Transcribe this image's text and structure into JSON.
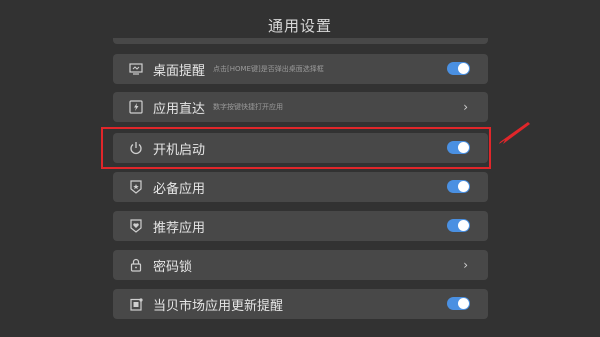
{
  "header": {
    "title": "通用设置"
  },
  "rows": [
    {
      "label": "桌面提醒",
      "desc": "点击[HOME键]是否弹出桌面选择框",
      "icon": "monitor-icon",
      "control": "toggle",
      "on": true
    },
    {
      "label": "应用直达",
      "desc": "数字按键快捷打开应用",
      "icon": "lightning-icon",
      "control": "chevron"
    },
    {
      "label": "开机启动",
      "desc": "",
      "icon": "power-icon",
      "control": "toggle",
      "on": true
    },
    {
      "label": "必备应用",
      "desc": "",
      "icon": "star-shield-icon",
      "control": "toggle",
      "on": true
    },
    {
      "label": "推荐应用",
      "desc": "",
      "icon": "heart-shield-icon",
      "control": "toggle",
      "on": true
    },
    {
      "label": "密码锁",
      "desc": "",
      "icon": "lock-icon",
      "control": "chevron"
    },
    {
      "label": "当贝市场应用更新提醒",
      "desc": "",
      "icon": "update-icon",
      "control": "toggle",
      "on": true
    }
  ],
  "chevron_glyph": "›",
  "colors": {
    "toggle_on": "#4a90e2",
    "highlight": "#e0262a",
    "row_bg": "#484848",
    "background": "#323232"
  }
}
